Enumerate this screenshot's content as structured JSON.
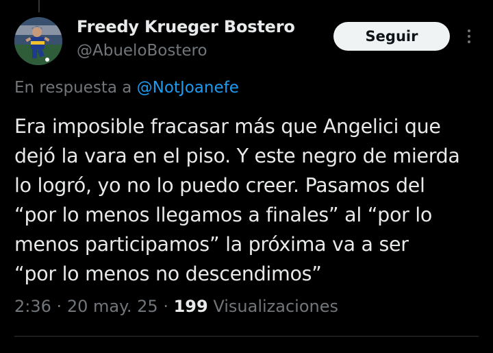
{
  "author": {
    "display_name": "Freedy Krueger Bostero",
    "handle": "@AbueloBostero"
  },
  "follow_button_label": "Seguir",
  "reply_context": {
    "prefix": "En respuesta a",
    "mention": "@NotJoanefe"
  },
  "tweet_lines": [
    "Era imposible fracasar más que Angelici que",
    "dejó la vara en el piso. Y este negro de mierda",
    "lo logró, yo no lo puedo creer. Pasamos del",
    "“por lo menos llegamos a finales” al “por lo",
    "menos participamos” la próxima va a ser",
    "“por lo menos no descendimos”"
  ],
  "meta": {
    "time": "2:36",
    "date": "20 may. 25",
    "separator": "·",
    "views_count": "199",
    "views_label": "Visualizaciones"
  },
  "icons": {
    "more": "more-options-icon"
  },
  "colors": {
    "background": "#000000",
    "text_primary": "#e7e9ea",
    "text_secondary": "#71767b",
    "accent": "#1d9bf0",
    "button_bg": "#eff3f4"
  }
}
